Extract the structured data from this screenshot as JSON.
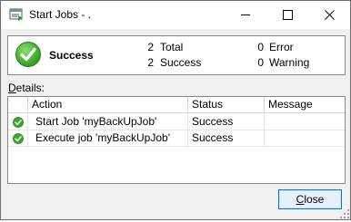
{
  "window": {
    "title": "Start Jobs - .",
    "icon": "start-jobs-icon",
    "controls": [
      "minimize",
      "maximize",
      "close"
    ]
  },
  "summary": {
    "status": "Success",
    "status_icon": "check-circle-icon",
    "total_count": "2",
    "total_label": "Total",
    "success_count": "2",
    "success_label": "Success",
    "error_count": "0",
    "error_label": "Error",
    "warning_count": "0",
    "warning_label": "Warning"
  },
  "details": {
    "label_prefix": "D",
    "label_rest": "etails:",
    "columns": [
      "Action",
      "Status",
      "Message"
    ],
    "rows": [
      {
        "action": "Start Job 'myBackUpJob'",
        "status": "Success",
        "message": ""
      },
      {
        "action": "Execute job 'myBackUpJob'",
        "status": "Success",
        "message": ""
      }
    ]
  },
  "buttons": {
    "close_prefix": "C",
    "close_rest": "lose"
  },
  "colors": {
    "success_green": "#3aa826",
    "accent_blue": "#0078d7"
  }
}
